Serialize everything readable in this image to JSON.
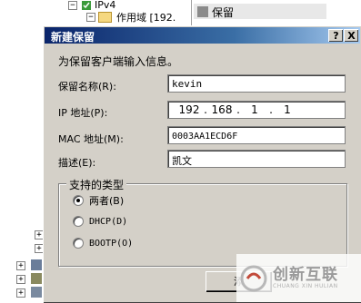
{
  "background": {
    "tree_items": [
      "IPv4",
      "作用域 [192."
    ],
    "right_pane_items": [
      "保留"
    ]
  },
  "dialog": {
    "title": "新建保留",
    "help_button": "?",
    "close_button": "X",
    "intro": "为保留客户端输入信息。",
    "reservation_name_label": "保留名称(R):",
    "reservation_name_value": "kevin",
    "ip_label": "IP 地址(P):",
    "ip_octets": [
      "192",
      "168",
      "1",
      "1"
    ],
    "ip_dot": ".",
    "mac_label": "MAC 地址(M):",
    "mac_value": "0003AA1ECD6F",
    "description_label": "描述(E):",
    "description_value": "凯文",
    "supported_types": {
      "title": "支持的类型",
      "options": [
        {
          "label": "两者(B)",
          "selected": true
        },
        {
          "label": "DHCP(D)",
          "selected": false
        },
        {
          "label": "BOOTP(O)",
          "selected": false
        }
      ]
    },
    "add_button": "添"
  },
  "watermark": {
    "text": "创新互联",
    "subtext": "CHUANG XIN HULIAN"
  }
}
